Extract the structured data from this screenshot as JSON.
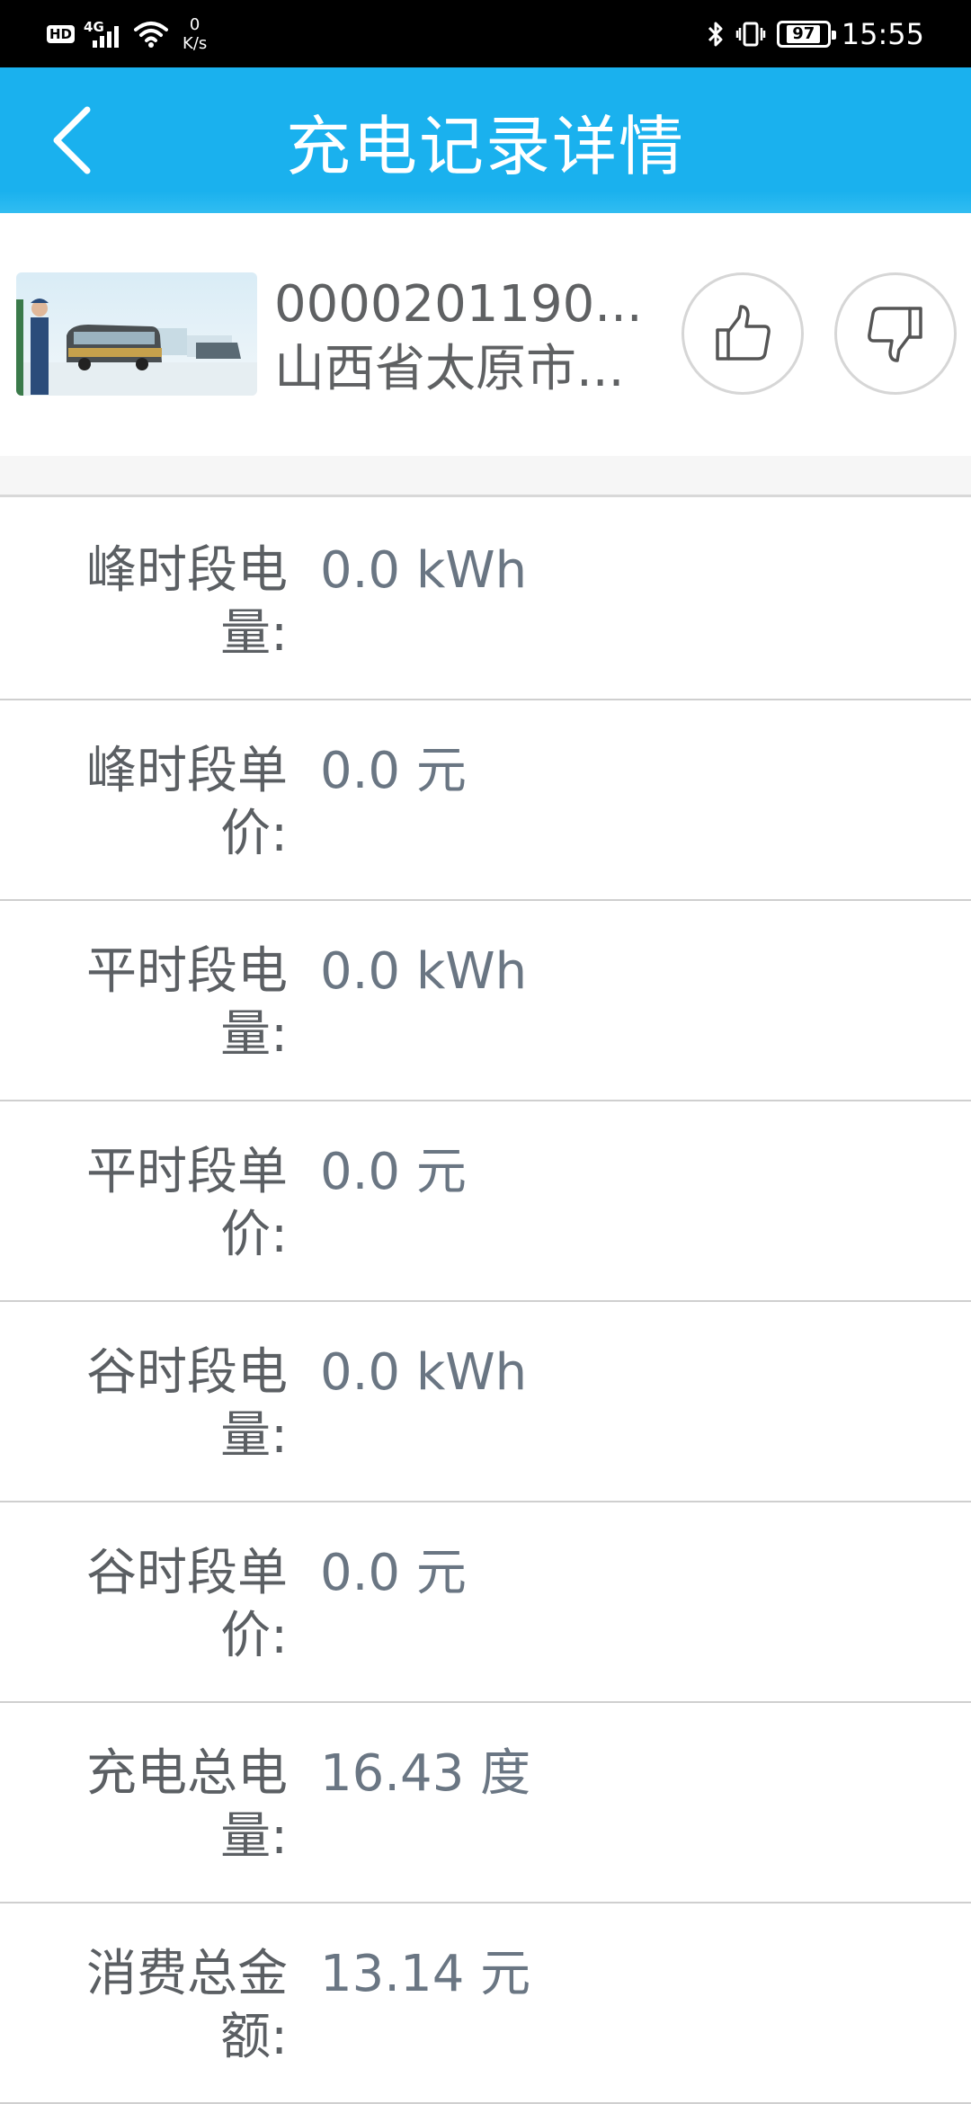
{
  "status_bar": {
    "hd": "HD",
    "network": "4G",
    "speed_value": "0",
    "speed_unit": "K/s",
    "battery": "97",
    "time": "15:55"
  },
  "header": {
    "title": "充电记录详情"
  },
  "station": {
    "code": "0000201190...",
    "address": "山西省太原市..."
  },
  "details": [
    {
      "label": "峰时段电量:",
      "value": "0.0 kWh"
    },
    {
      "label": "峰时段单价:",
      "value": "0.0 元"
    },
    {
      "label": "平时段电量:",
      "value": "0.0 kWh"
    },
    {
      "label": "平时段单价:",
      "value": "0.0 元"
    },
    {
      "label": "谷时段电量:",
      "value": "0.0 kWh"
    },
    {
      "label": "谷时段单价:",
      "value": "0.0 元"
    },
    {
      "label": "充电总电量:",
      "value": "16.43 度"
    },
    {
      "label": "消费总金额:",
      "value": "13.14 元"
    }
  ],
  "colors": {
    "header_bg": "#1ab1ee",
    "label_text": "#5b5f63",
    "value_text": "#6a7683"
  }
}
